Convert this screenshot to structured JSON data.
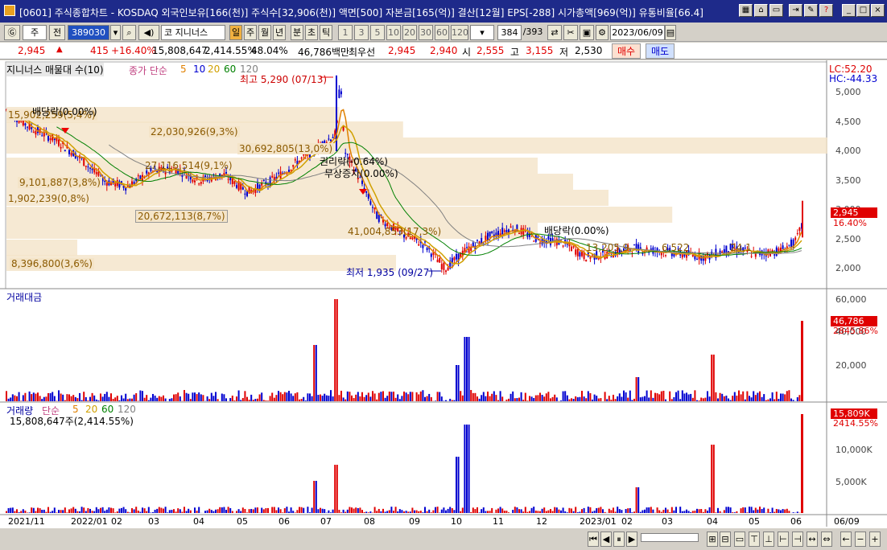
{
  "window": {
    "title": "[0601] 주식종합차트 - KOSDAQ 외국인보유[166(천)] 주식수[32,906(천)] 액면[500] 자본금[165(억)] 결산[12월] EPS[-288] 시가총액[969(억)] 유통비율[66.4]"
  },
  "toolbar": {
    "market": "주",
    "type": "전",
    "code": "389030",
    "stock_name": "코 지니너스",
    "periods": [
      "일",
      "주",
      "월",
      "년",
      "분",
      "초",
      "틱"
    ],
    "minutes": [
      "1",
      "3",
      "5",
      "10",
      "20",
      "30",
      "60",
      "120"
    ],
    "count": "384",
    "total": "/393",
    "date": "2023/06/09"
  },
  "quote": {
    "price": "2,945",
    "arrow": "▲",
    "change": "415",
    "change_pct": "+16.40%",
    "volume": "15,808,647",
    "vol_ratio": "2,414.55%",
    "rate": "48.04%",
    "amount": "46,786백만",
    "best_label": "최우선",
    "best_ask": "2,945",
    "best_bid": "2,940",
    "open_label": "시",
    "open": "2,555",
    "high_label": "고",
    "high": "3,155",
    "low_label": "저",
    "low": "2,530",
    "buy": "매수",
    "sell": "매도"
  },
  "price_panel": {
    "legend_stock": "지니너스 매물대 수(10)",
    "legend_ma": "종가 단순",
    "ma_periods": [
      "5",
      "10",
      "20",
      "60",
      "120"
    ],
    "lc": "LC:52.20",
    "hc": "HC:-44.33",
    "high_mark": "최고 5,290 (07/13)",
    "low_mark": "최저 1,935 (09/27)",
    "div1": "배당락(0.00%)",
    "div2": "배당락(0.00%)",
    "noticed": "무상증자(0.00%)",
    "right": "권리락(-0.64%)",
    "cur_price": "2,945",
    "cur_pct": "16.40%",
    "yticks": [
      "5,000",
      "4,500",
      "4,000",
      "3,500",
      "3,000",
      "2,500",
      "2,000"
    ],
    "volume_profile": [
      "15,902,259(5,4%)",
      "22,030,926(9,3%)",
      "30,692,805(13,0%)",
      "27,116,514(9,1%)",
      "9,101,887(3,8%)",
      "1,902,239(0,8%)",
      "20,672,113(8,7%)",
      "41,004,853(17,3%)",
      "8,396,800(3,6%)",
      "13,205,9",
      "6,522",
      "24,1"
    ]
  },
  "amount_panel": {
    "title": "거래대금",
    "cur": "46,786",
    "pct": "2845.86%",
    "yticks": [
      "60,000",
      "40,000",
      "20,000"
    ]
  },
  "volume_panel": {
    "title": "거래량",
    "legend": "단순",
    "ma_periods": [
      "5",
      "20",
      "60",
      "120"
    ],
    "cur_line": "15,808,647주(2,414.55%)",
    "cur": "15,809K",
    "pct": "2414.55%",
    "yticks": [
      "10,000K",
      "5,000K"
    ]
  },
  "xaxis": [
    "2021/11",
    "2022/01",
    "02",
    "03",
    "04",
    "05",
    "06",
    "07",
    "08",
    "09",
    "10",
    "11",
    "12",
    "2023/01",
    "02",
    "03",
    "04",
    "05",
    "06",
    "06/09"
  ],
  "colors": {
    "up": "#e00000",
    "down": "#0000d0",
    "ma5": "#e08000",
    "ma20": "#d0a000",
    "ma60": "#008000",
    "ma120": "#808080",
    "profile": "#f4e4c8"
  },
  "chart_data": {
    "type": "candlestick",
    "series": [
      {
        "name": "종가",
        "approx_path": [
          [
            0,
            4700
          ],
          [
            30,
            4400
          ],
          [
            60,
            4200
          ],
          [
            90,
            3900
          ],
          [
            120,
            3500
          ],
          [
            150,
            3400
          ],
          [
            180,
            3650
          ],
          [
            210,
            3700
          ],
          [
            240,
            3500
          ],
          [
            270,
            3600
          ],
          [
            300,
            3300
          ],
          [
            330,
            3500
          ],
          [
            360,
            3800
          ],
          [
            390,
            4100
          ],
          [
            410,
            4300
          ],
          [
            415,
            5290
          ],
          [
            420,
            4000
          ],
          [
            440,
            3500
          ],
          [
            460,
            2900
          ],
          [
            490,
            2600
          ],
          [
            520,
            2400
          ],
          [
            545,
            2000
          ],
          [
            570,
            2300
          ],
          [
            600,
            2550
          ],
          [
            630,
            2700
          ],
          [
            660,
            2500
          ],
          [
            690,
            2450
          ],
          [
            720,
            2200
          ],
          [
            750,
            2250
          ],
          [
            780,
            2350
          ],
          [
            810,
            2300
          ],
          [
            840,
            2250
          ],
          [
            870,
            2200
          ],
          [
            900,
            2350
          ],
          [
            930,
            2250
          ],
          [
            960,
            2300
          ],
          [
            980,
            2450
          ],
          [
            995,
            2945
          ]
        ]
      }
    ]
  }
}
